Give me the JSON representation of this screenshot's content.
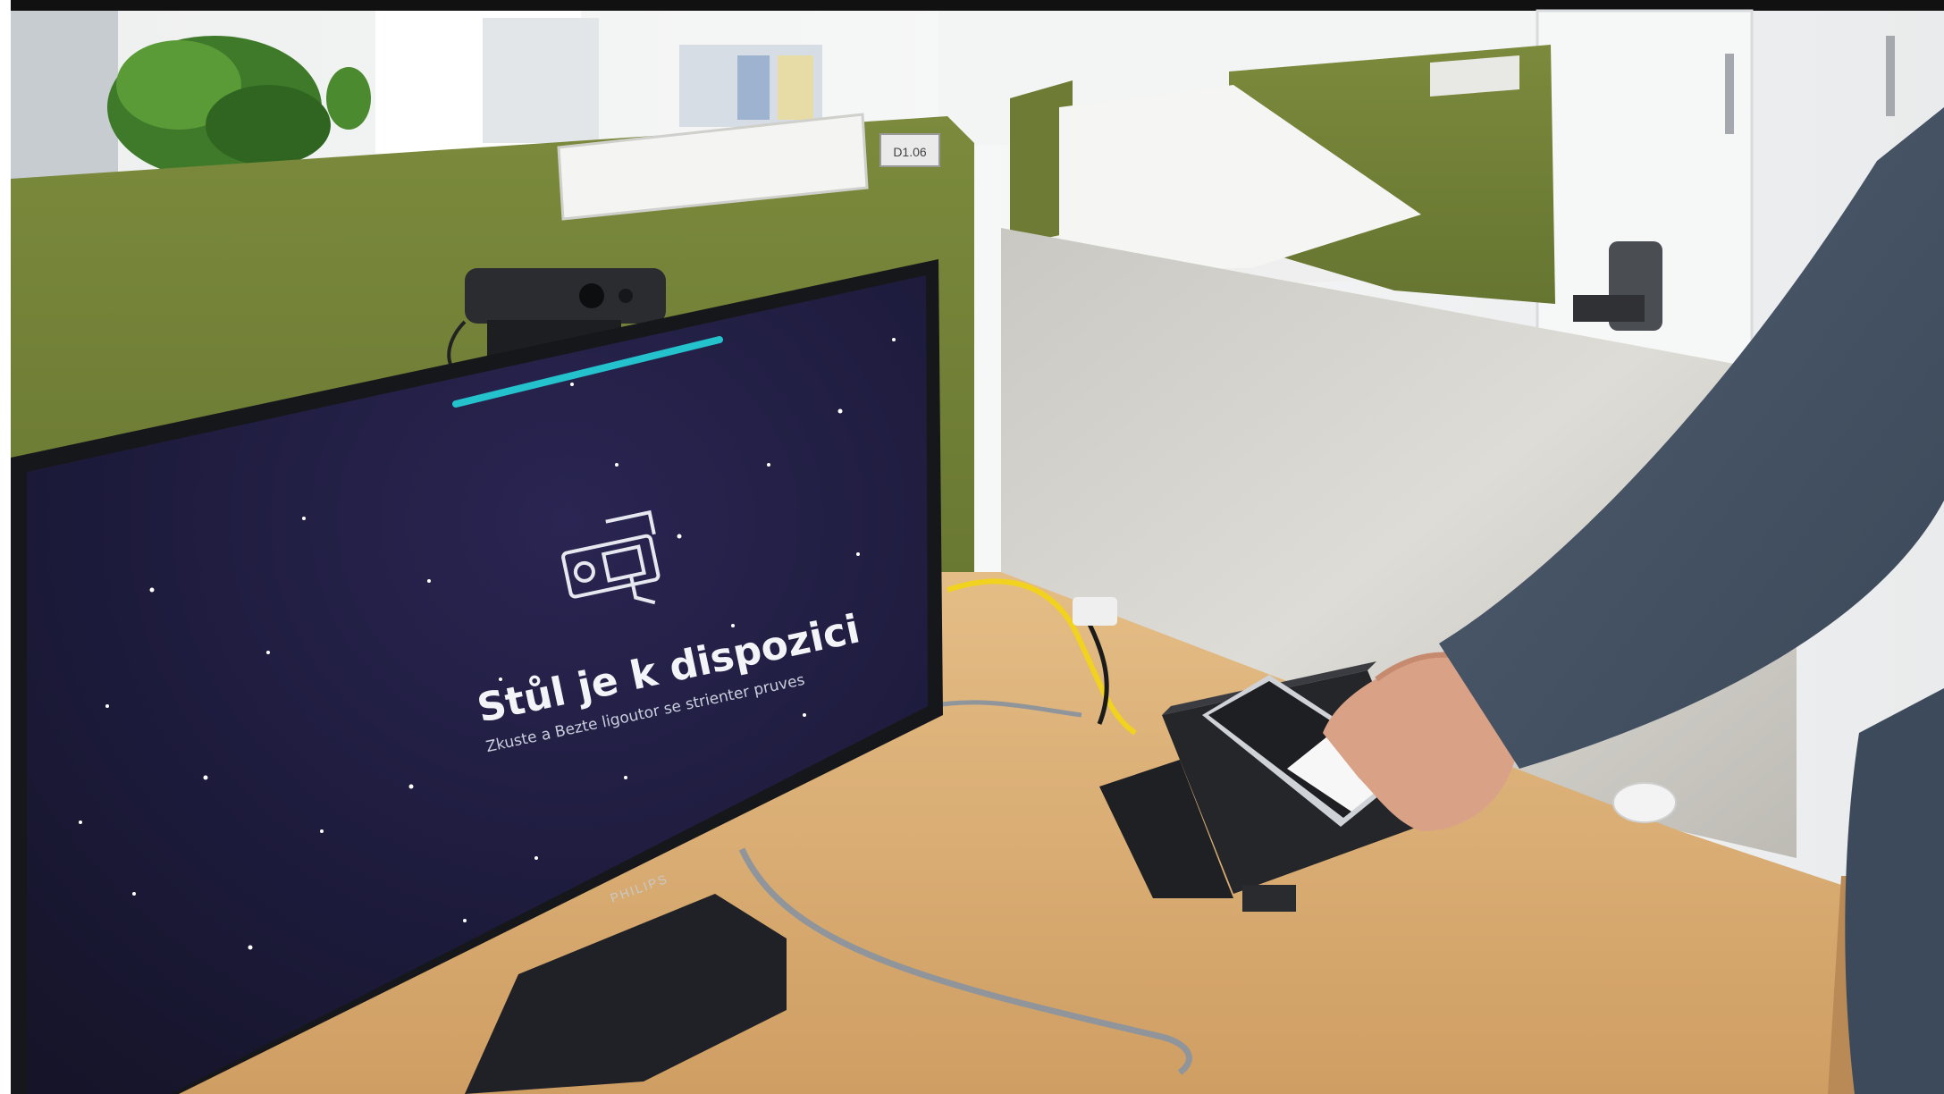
{
  "image": {
    "kind": "photo",
    "content": "office-hot-desk-with-monitor-webcam-and-phone-reader"
  },
  "monitor_screen": {
    "title": "Stůl je k dispozici",
    "subtitle": "Zkuste a Bezte ligoutor se strienter pruves",
    "icon": "desk-card-reader-icon",
    "progress_bar_color": "#23c2cc",
    "background_color": "#1c1a3a"
  },
  "monitor": {
    "brand": "PHILIPS"
  },
  "desk_label": "D1.06",
  "colors": {
    "partition_green": "#6f7d35",
    "desk_wood": "#d9ad73",
    "sleeve": "#455466",
    "monitor_bezel": "#16171b"
  }
}
